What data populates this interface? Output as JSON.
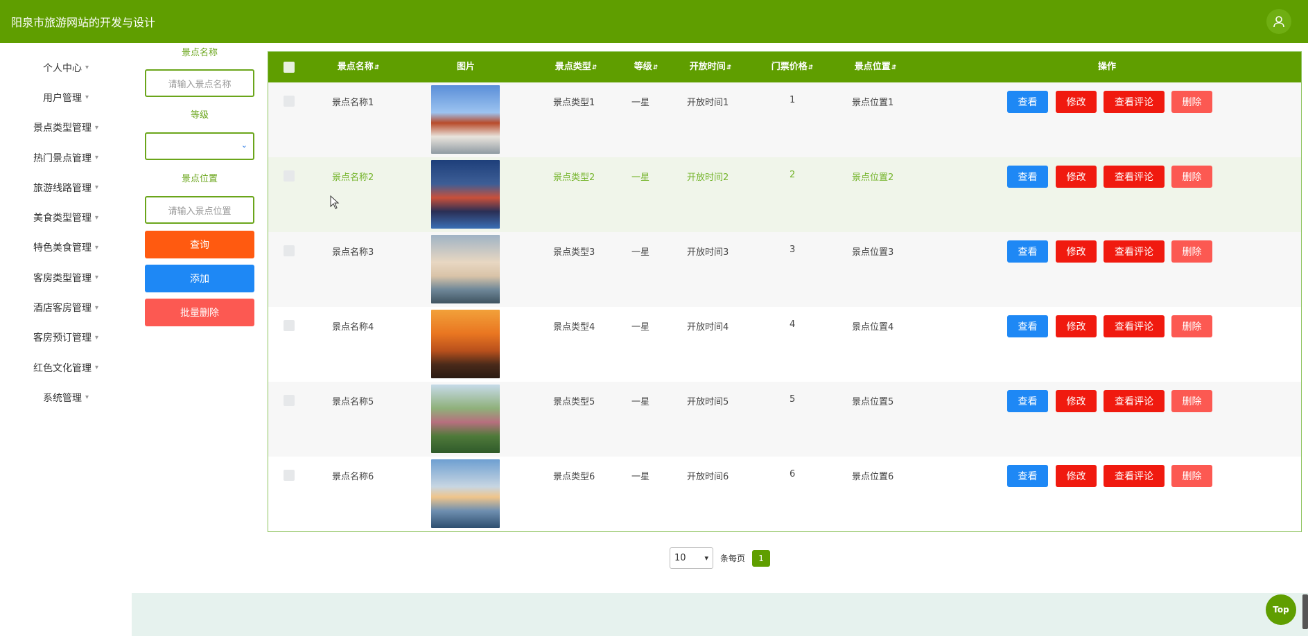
{
  "header": {
    "title": "阳泉市旅游网站的开发与设计",
    "user_icon": "user-icon"
  },
  "sidebar": {
    "items": [
      {
        "label": "个人中心"
      },
      {
        "label": "用户管理"
      },
      {
        "label": "景点类型管理"
      },
      {
        "label": "热门景点管理"
      },
      {
        "label": "旅游线路管理"
      },
      {
        "label": "美食类型管理"
      },
      {
        "label": "特色美食管理"
      },
      {
        "label": "客房类型管理"
      },
      {
        "label": "酒店客房管理"
      },
      {
        "label": "客房预订管理"
      },
      {
        "label": "红色文化管理"
      },
      {
        "label": "系统管理"
      }
    ],
    "caret": "▾"
  },
  "filter": {
    "name_label": "景点名称",
    "name_placeholder": "请输入景点名称",
    "level_label": "等级",
    "level_value": "",
    "location_label": "景点位置",
    "location_placeholder": "请输入景点位置",
    "query_label": "查询",
    "add_label": "添加",
    "batch_delete_label": "批量删除"
  },
  "table": {
    "headers": {
      "name": "景点名称",
      "picture": "图片",
      "type": "景点类型",
      "level": "等级",
      "open_time": "开放时间",
      "price": "门票价格",
      "location": "景点位置",
      "actions": "操作"
    },
    "sort_icon": "sort-icon",
    "rows": [
      {
        "name": "景点名称1",
        "type": "景点类型1",
        "level": "一星",
        "open_time": "开放时间1",
        "price": "1",
        "location": "景点位置1"
      },
      {
        "name": "景点名称2",
        "type": "景点类型2",
        "level": "一星",
        "open_time": "开放时间2",
        "price": "2",
        "location": "景点位置2"
      },
      {
        "name": "景点名称3",
        "type": "景点类型3",
        "level": "一星",
        "open_time": "开放时间3",
        "price": "3",
        "location": "景点位置3"
      },
      {
        "name": "景点名称4",
        "type": "景点类型4",
        "level": "一星",
        "open_time": "开放时间4",
        "price": "4",
        "location": "景点位置4"
      },
      {
        "name": "景点名称5",
        "type": "景点类型5",
        "level": "一星",
        "open_time": "开放时间5",
        "price": "5",
        "location": "景点位置5"
      },
      {
        "name": "景点名称6",
        "type": "景点类型6",
        "level": "一星",
        "open_time": "开放时间6",
        "price": "6",
        "location": "景点位置6"
      }
    ],
    "actions": {
      "view": "查看",
      "edit": "修改",
      "comments": "查看评论",
      "delete": "删除"
    }
  },
  "pager": {
    "page_size": "10",
    "per_page_label": "条每页",
    "current_page": "1"
  },
  "top_button": "Top",
  "colors": {
    "primary": "#5f9e00",
    "view": "#1e88f5",
    "edit": "#f01a0f",
    "delete": "#fc5952",
    "query": "#ff5a10"
  }
}
